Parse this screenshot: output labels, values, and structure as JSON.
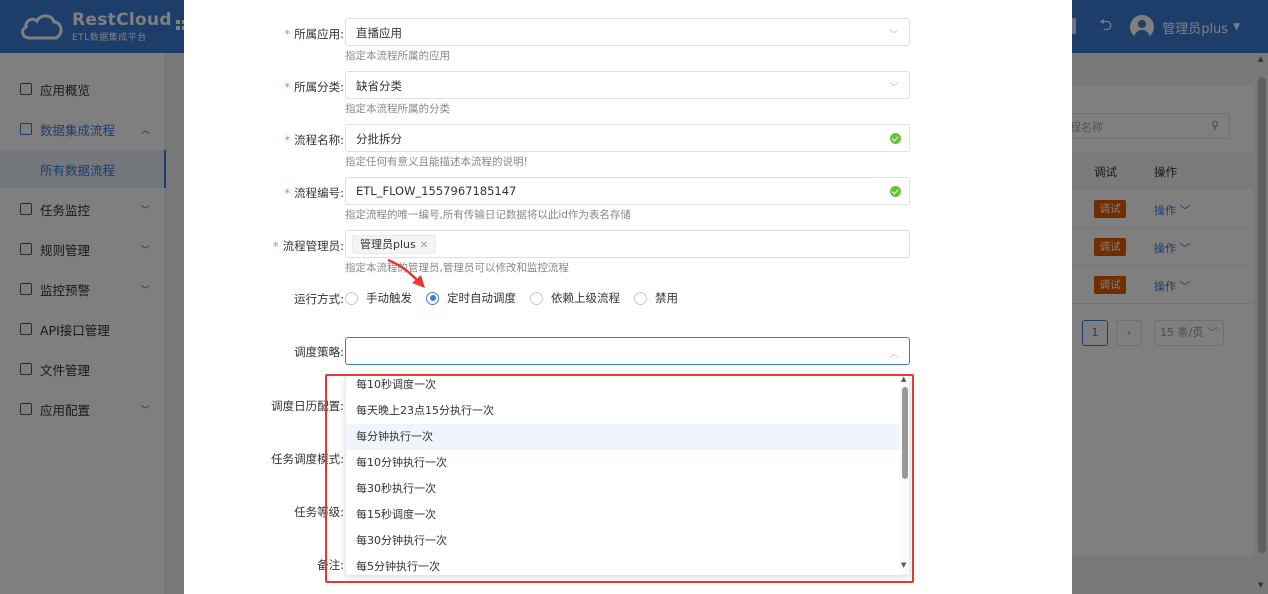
{
  "header": {
    "brand_name": "RestCloud",
    "brand_sub": "ETL数据集成平台",
    "user_name": "管理员plus"
  },
  "sidebar": {
    "items": [
      {
        "label": "应用概览"
      },
      {
        "label": "数据集成流程"
      },
      {
        "label": "所有数据流程"
      },
      {
        "label": "任务监控"
      },
      {
        "label": "规则管理"
      },
      {
        "label": "监控预警"
      },
      {
        "label": "API接口管理"
      },
      {
        "label": "文件管理"
      },
      {
        "label": "应用配置"
      }
    ]
  },
  "background": {
    "search_placeholder": "程名称",
    "col_debug": "调试",
    "col_action": "操作",
    "debug_btn": "调试",
    "action_link": "操作",
    "current_page": "1",
    "page_size": "15 条/页"
  },
  "form": {
    "app": {
      "label": "所属应用:",
      "value": "直播应用",
      "hint": "指定本流程所属的应用"
    },
    "category": {
      "label": "所属分类:",
      "value": "缺省分类",
      "hint": "指定本流程所属的分类"
    },
    "name": {
      "label": "流程名称:",
      "value": "分批拆分",
      "hint": "指定任何有意义且能描述本流程的说明!"
    },
    "code": {
      "label": "流程编号:",
      "value": "ETL_FLOW_1557967185147",
      "hint": "指定流程的唯一编号,所有传输日记数据将以此id作为表名存储"
    },
    "manager": {
      "label": "流程管理员:",
      "tag": "管理员plus",
      "hint": "指定本流程的管理员,管理员可以修改和监控流程"
    },
    "run_mode": {
      "label": "运行方式:",
      "options": [
        "手动触发",
        "定时自动调度",
        "依赖上级流程",
        "禁用"
      ],
      "selected": "定时自动调度"
    },
    "strategy": {
      "label": "调度策略:",
      "value": ""
    },
    "calendar_label": "调度日历配置:",
    "task_mode_label": "任务调度模式:",
    "task_level_label": "任务等级:",
    "remark_label": "备注:"
  },
  "dropdown": {
    "options": [
      "每10秒调度一次",
      "每天晚上23点15分执行一次",
      "每分钟执行一次",
      "每10分钟执行一次",
      "每30秒执行一次",
      "每15秒调度一次",
      "每30分钟执行一次",
      "每5分钟执行一次"
    ],
    "highlighted": "每分钟执行一次"
  },
  "colors": {
    "primary": "#3a7bd5",
    "debug_button": "#e05a00",
    "required": "#f56c6c",
    "annotation": "#e53935"
  }
}
